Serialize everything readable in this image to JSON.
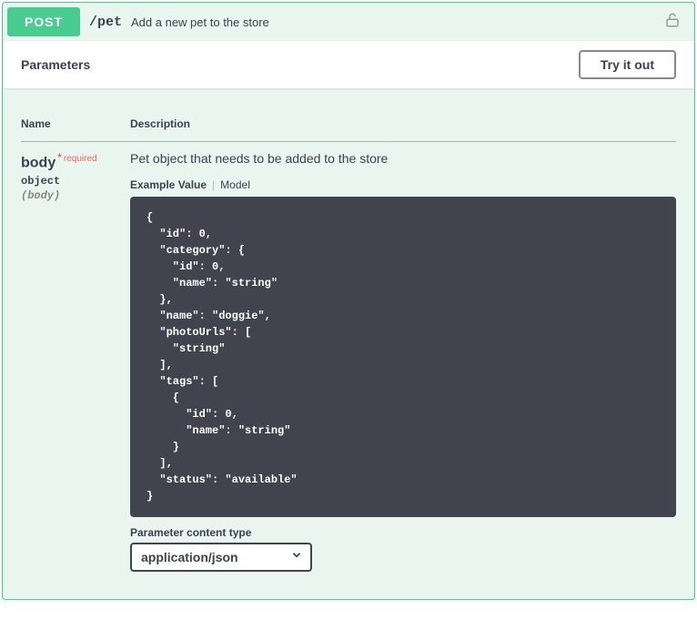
{
  "operation": {
    "method": "POST",
    "path": "/pet",
    "summary": "Add a new pet to the store"
  },
  "section": {
    "title": "Parameters",
    "try_label": "Try it out"
  },
  "columns": {
    "name": "Name",
    "description": "Description"
  },
  "param": {
    "name": "body",
    "required_star": "*",
    "required_text": "required",
    "type": "object",
    "in": "(body)",
    "description": "Pet object that needs to be added to the store"
  },
  "tabs": {
    "example": "Example Value",
    "model": "Model"
  },
  "example_value": "{\n  \"id\": 0,\n  \"category\": {\n    \"id\": 0,\n    \"name\": \"string\"\n  },\n  \"name\": \"doggie\",\n  \"photoUrls\": [\n    \"string\"\n  ],\n  \"tags\": [\n    {\n      \"id\": 0,\n      \"name\": \"string\"\n    }\n  ],\n  \"status\": \"available\"\n}",
  "content_type": {
    "label": "Parameter content type",
    "selected": "application/json"
  }
}
